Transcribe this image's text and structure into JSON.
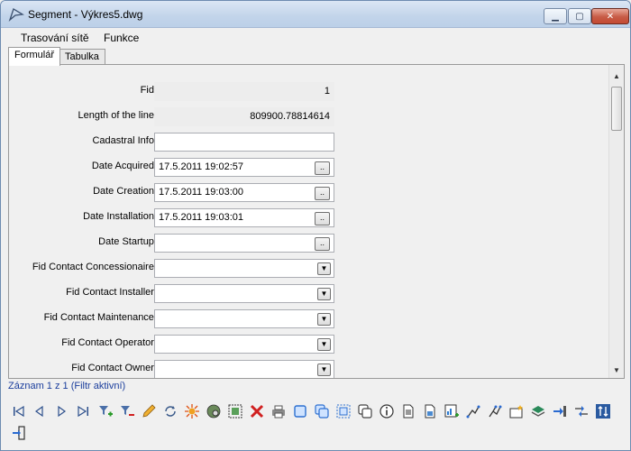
{
  "window": {
    "title": "Segment - Výkres5.dwg",
    "controls": {
      "minimize": "▁",
      "maximize": "▢",
      "close": "✕"
    }
  },
  "menu": [
    "Trasování sítě",
    "Funkce"
  ],
  "tabs": [
    {
      "label": "Formulář",
      "active": true
    },
    {
      "label": "Tabulka",
      "active": false
    }
  ],
  "form": {
    "rows": [
      {
        "label": "Fid:",
        "value": "1",
        "type": "readonly"
      },
      {
        "label": "Length of the line:",
        "value": "809900.78814614",
        "type": "readonly"
      },
      {
        "label": "Cadastral Info:",
        "value": "",
        "type": "text"
      },
      {
        "label": "Date Acquired:",
        "value": "17.5.2011 19:02:57",
        "type": "date"
      },
      {
        "label": "Date Creation:",
        "value": "17.5.2011 19:03:00",
        "type": "date"
      },
      {
        "label": "Date Installation:",
        "value": "17.5.2011 19:03:01",
        "type": "date"
      },
      {
        "label": "Date Startup:",
        "value": "",
        "type": "date"
      },
      {
        "label": "Fid Contact Concessionaire:",
        "value": "",
        "type": "dropdown"
      },
      {
        "label": "Fid Contact Installer:",
        "value": "",
        "type": "dropdown"
      },
      {
        "label": "Fid Contact Maintenance:",
        "value": "",
        "type": "dropdown"
      },
      {
        "label": "Fid Contact Operator:",
        "value": "",
        "type": "dropdown"
      },
      {
        "label": "Fid Contact Owner:",
        "value": "",
        "type": "dropdown"
      }
    ],
    "date_button_label": "..",
    "dropdown_glyph": "▼"
  },
  "status_text": "Záznam 1 z 1 (Filtr aktivní)",
  "toolbar_icons": [
    "first-record-icon",
    "previous-record-icon",
    "next-record-icon",
    "last-record-icon",
    "add-filter-icon",
    "remove-filter-icon",
    "edit-pencil-icon",
    "refresh-icon",
    "highlight-icon",
    "zoom-to-icon",
    "select-icon",
    "delete-icon",
    "print-icon",
    "copy-icon",
    "copy-multiple-icon",
    "select-area-icon",
    "duplicate-icon",
    "info-icon",
    "document-icon",
    "report-icon",
    "chart-add-icon",
    "trace-icon",
    "trace-network-icon",
    "new-record-icon",
    "layers-icon",
    "export-icon",
    "connect-icon",
    "sort-icon",
    "exit-icon"
  ]
}
